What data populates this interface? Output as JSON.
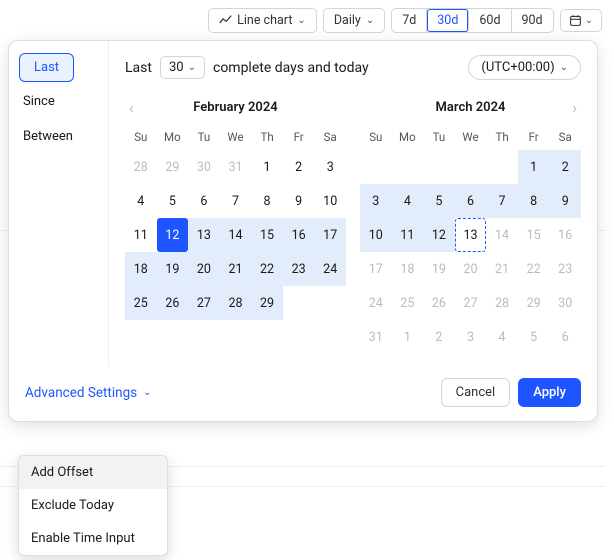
{
  "toolbar": {
    "chart_type_label": "Line chart",
    "granularity_label": "Daily",
    "ranges": [
      "7d",
      "30d",
      "60d",
      "90d"
    ],
    "active_range_index": 1
  },
  "side_tabs": {
    "items": [
      "Last",
      "Since",
      "Between"
    ],
    "active_index": 0
  },
  "sentence": {
    "prefix": "Last",
    "days_value": "30",
    "suffix": "complete days and today",
    "timezone": "(UTC+00:00)"
  },
  "calendars": [
    {
      "title": "February 2024",
      "dow": [
        "Su",
        "Mo",
        "Tu",
        "We",
        "Th",
        "Fr",
        "Sa"
      ],
      "cells": [
        {
          "n": 28,
          "out": true
        },
        {
          "n": 29,
          "out": true
        },
        {
          "n": 30,
          "out": true
        },
        {
          "n": 31,
          "out": true
        },
        {
          "n": 1
        },
        {
          "n": 2
        },
        {
          "n": 3
        },
        {
          "n": 4
        },
        {
          "n": 5
        },
        {
          "n": 6
        },
        {
          "n": 7
        },
        {
          "n": 8
        },
        {
          "n": 9
        },
        {
          "n": 10
        },
        {
          "n": 11
        },
        {
          "n": 12,
          "sel": true
        },
        {
          "n": 13,
          "range": true
        },
        {
          "n": 14,
          "range": true
        },
        {
          "n": 15,
          "range": true
        },
        {
          "n": 16,
          "range": true
        },
        {
          "n": 17,
          "range": true
        },
        {
          "n": 18,
          "range": true
        },
        {
          "n": 19,
          "range": true
        },
        {
          "n": 20,
          "range": true
        },
        {
          "n": 21,
          "range": true
        },
        {
          "n": 22,
          "range": true
        },
        {
          "n": 23,
          "range": true
        },
        {
          "n": 24,
          "range": true
        },
        {
          "n": 25,
          "range": true
        },
        {
          "n": 26,
          "range": true
        },
        {
          "n": 27,
          "range": true
        },
        {
          "n": 28,
          "range": true
        },
        {
          "n": 29,
          "range": true
        }
      ]
    },
    {
      "title": "March 2024",
      "dow": [
        "Su",
        "Mo",
        "Tu",
        "We",
        "Th",
        "Fr",
        "Sa"
      ],
      "cells": [
        {
          "blank": true
        },
        {
          "blank": true
        },
        {
          "blank": true
        },
        {
          "blank": true
        },
        {
          "blank": true
        },
        {
          "n": 1,
          "range": true
        },
        {
          "n": 2,
          "range": true
        },
        {
          "n": 3,
          "range": true
        },
        {
          "n": 4,
          "range": true
        },
        {
          "n": 5,
          "range": true
        },
        {
          "n": 6,
          "range": true
        },
        {
          "n": 7,
          "range": true
        },
        {
          "n": 8,
          "range": true
        },
        {
          "n": 9,
          "range": true
        },
        {
          "n": 10,
          "range": true
        },
        {
          "n": 11,
          "range": true
        },
        {
          "n": 12,
          "range": true
        },
        {
          "n": 13,
          "today": true
        },
        {
          "n": 14,
          "out": true
        },
        {
          "n": 15,
          "out": true
        },
        {
          "n": 16,
          "out": true
        },
        {
          "n": 17,
          "out": true
        },
        {
          "n": 18,
          "out": true
        },
        {
          "n": 19,
          "out": true
        },
        {
          "n": 20,
          "out": true
        },
        {
          "n": 21,
          "out": true
        },
        {
          "n": 22,
          "out": true
        },
        {
          "n": 23,
          "out": true
        },
        {
          "n": 24,
          "out": true
        },
        {
          "n": 25,
          "out": true
        },
        {
          "n": 26,
          "out": true
        },
        {
          "n": 27,
          "out": true
        },
        {
          "n": 28,
          "out": true
        },
        {
          "n": 29,
          "out": true
        },
        {
          "n": 30,
          "out": true
        },
        {
          "n": 31,
          "out": true
        },
        {
          "n": 1,
          "out": true
        },
        {
          "n": 2,
          "out": true
        },
        {
          "n": 3,
          "out": true
        },
        {
          "n": 4,
          "out": true
        },
        {
          "n": 5,
          "out": true
        },
        {
          "n": 6,
          "out": true
        }
      ]
    }
  ],
  "footer": {
    "advanced_label": "Advanced Settings",
    "cancel_label": "Cancel",
    "apply_label": "Apply"
  },
  "menu": {
    "items": [
      "Add Offset",
      "Exclude Today",
      "Enable Time Input"
    ],
    "hover_index": 0
  }
}
